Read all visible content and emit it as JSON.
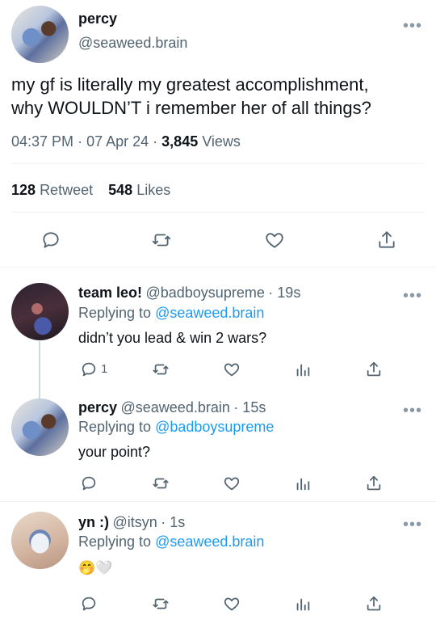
{
  "main_tweet": {
    "name": "percy",
    "handle": "@seaweed.brain",
    "text_line1": "my gf is literally my greatest accomplishment,",
    "text_line2": "why WOULDN’T i remember her of all things?",
    "time": "04:37 PM",
    "date": "07 Apr 24",
    "views_count": "3,845",
    "views_label": "Views",
    "retweets_count": "128",
    "retweets_label": "Retweet",
    "likes_count": "548",
    "likes_label": "Likes",
    "more": "•••",
    "sep": "·"
  },
  "replies": [
    {
      "name": "team leo!",
      "handle": "@badboysupreme",
      "time": "· 19s",
      "replying_prefix": "Replying to",
      "replying_to": "@seaweed.brain",
      "text": "didn’t you lead & win 2 wars?",
      "reply_count": "1",
      "more": "•••"
    },
    {
      "name": "percy",
      "handle": "@seaweed.brain",
      "time": "· 15s",
      "replying_prefix": "Replying to",
      "replying_to": "@badboysupreme",
      "text": "your point?",
      "reply_count": "",
      "more": "•••"
    },
    {
      "name": "yn :)",
      "handle": "@itsyn",
      "time": "· 1s",
      "replying_prefix": "Replying to",
      "replying_to": "@seaweed.brain",
      "text": "🤭🤍",
      "reply_count": "",
      "more": "•••"
    }
  ],
  "icons": {
    "reply": "reply-icon",
    "retweet": "retweet-icon",
    "like": "heart-icon",
    "share": "share-icon",
    "analytics": "analytics-icon"
  },
  "colors": {
    "link": "#1d9bf0",
    "secondary_text": "#536471",
    "icon": "#536471"
  }
}
